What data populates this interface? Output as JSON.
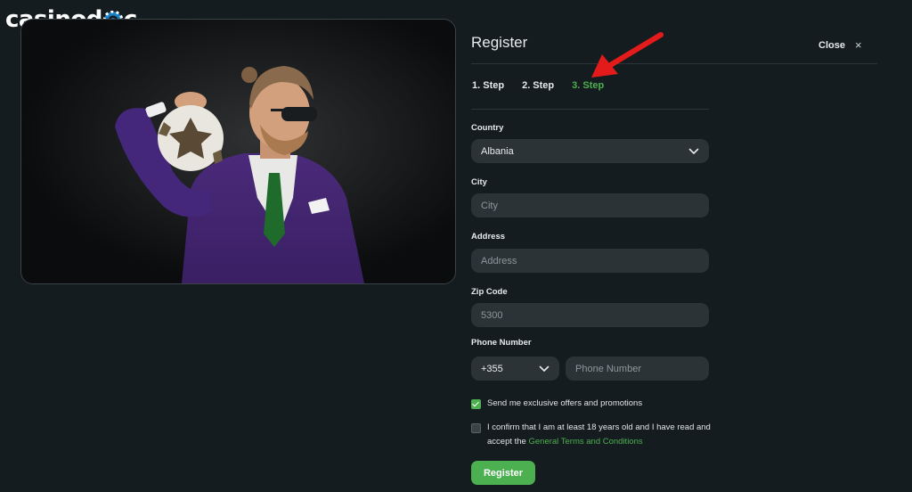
{
  "brand": {
    "logo_prefix": "casinod",
    "logo_suffix": "c"
  },
  "modal": {
    "title": "Register",
    "close_label": "Close",
    "close_icon": "×"
  },
  "steps": [
    {
      "label": "1. Step",
      "active": false
    },
    {
      "label": "2. Step",
      "active": false
    },
    {
      "label": "3. Step",
      "active": true
    }
  ],
  "form": {
    "country": {
      "label": "Country",
      "value": "Albania"
    },
    "city": {
      "label": "City",
      "placeholder": "City"
    },
    "address": {
      "label": "Address",
      "placeholder": "Address"
    },
    "zip": {
      "label": "Zip Code",
      "placeholder": "5300"
    },
    "phone": {
      "label": "Phone Number",
      "code": "+355",
      "placeholder": "Phone Number"
    },
    "offers": {
      "label": "Send me exclusive offers and promotions",
      "checked": true
    },
    "terms": {
      "text_before": "I confirm that I am at least 18 years old and I have read and accept the ",
      "link_text": "General Terms and Conditions",
      "checked": false
    },
    "submit_label": "Register"
  },
  "colors": {
    "background": "#151c1f",
    "accent": "#4caf50",
    "field": "#2c3336",
    "annotation_arrow": "#e31b1b"
  }
}
